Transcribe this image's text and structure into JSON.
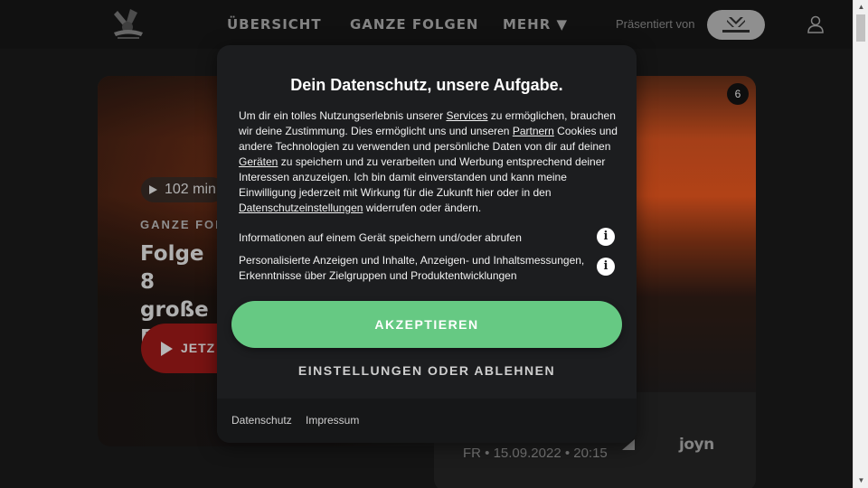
{
  "header": {
    "nav": [
      "ÜBERSICHT",
      "GANZE FOLGEN",
      "MEHR ▼"
    ],
    "presented_by": "Präsentiert von"
  },
  "hero": {
    "badge_count": "6",
    "duration": "102 min",
    "category": "GANZE FOLG",
    "title_line1": "Folge 8",
    "title_line2": "große F",
    "play_label": "JETZ",
    "air_date": "FR • 15.09.2022 • 20:15",
    "streaming_logo": "joyn"
  },
  "dialog": {
    "title": "Dein Datenschutz, unsere Aufgabe.",
    "body": {
      "t1": "Um dir ein tolles Nutzungserlebnis unserer ",
      "link_services": "Services",
      "t2": " zu ermöglichen, brauchen wir deine Zustimmung. Dies ermöglicht uns und unseren ",
      "link_partners": "Partnern",
      "t3": " Cookies und andere Technologien zu verwenden und persönliche Daten von dir auf deinen ",
      "link_devices": "Geräten",
      "t4": " zu speichern und zu verarbeiten und Werbung entsprechend deiner Interessen anzuzeigen. Ich bin damit einverstanden und kann meine Einwilligung jederzeit mit Wirkung für die Zukunft hier oder in den ",
      "link_settings": "Datenschutzeinstellungen",
      "t5": " widerrufen oder ändern."
    },
    "purposes": [
      "Informationen auf einem Gerät speichern und/oder abrufen",
      "Personalisierte Anzeigen und Inhalte, Anzeigen- und Inhaltsmessungen, Erkenntnisse über Zielgruppen und Produktentwicklungen"
    ],
    "info_glyph": "i",
    "accept_label": "AKZEPTIEREN",
    "settings_label": "EINSTELLUNGEN ODER ABLEHNEN",
    "footer_links": [
      "Datenschutz",
      "Impressum"
    ]
  },
  "colors": {
    "accept": "#66c983",
    "dialog_bg": "#1c1d1f",
    "play_red": "#8e1716"
  }
}
